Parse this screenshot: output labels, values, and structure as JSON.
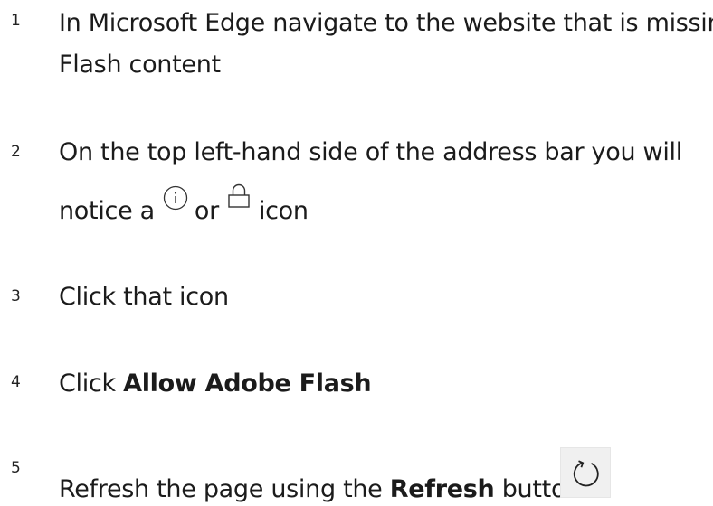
{
  "steps": [
    {
      "num": "1",
      "line1": "In Microsoft Edge navigate to the website that is missing",
      "line2": "Flash content"
    },
    {
      "num": "2",
      "line1": "On the top left-hand side of the address bar you will",
      "line2_pre": "notice a",
      "line2_mid": "or",
      "line2_post": "icon",
      "icons": [
        "info-icon",
        "lock-icon"
      ]
    },
    {
      "num": "3",
      "text": "Click that icon"
    },
    {
      "num": "4",
      "pre": "Click ",
      "bold": "Allow Adobe Flash"
    },
    {
      "num": "5",
      "pre": "Refresh the page using the ",
      "bold": "Refresh",
      "post": " button",
      "icon": "refresh-icon"
    }
  ]
}
